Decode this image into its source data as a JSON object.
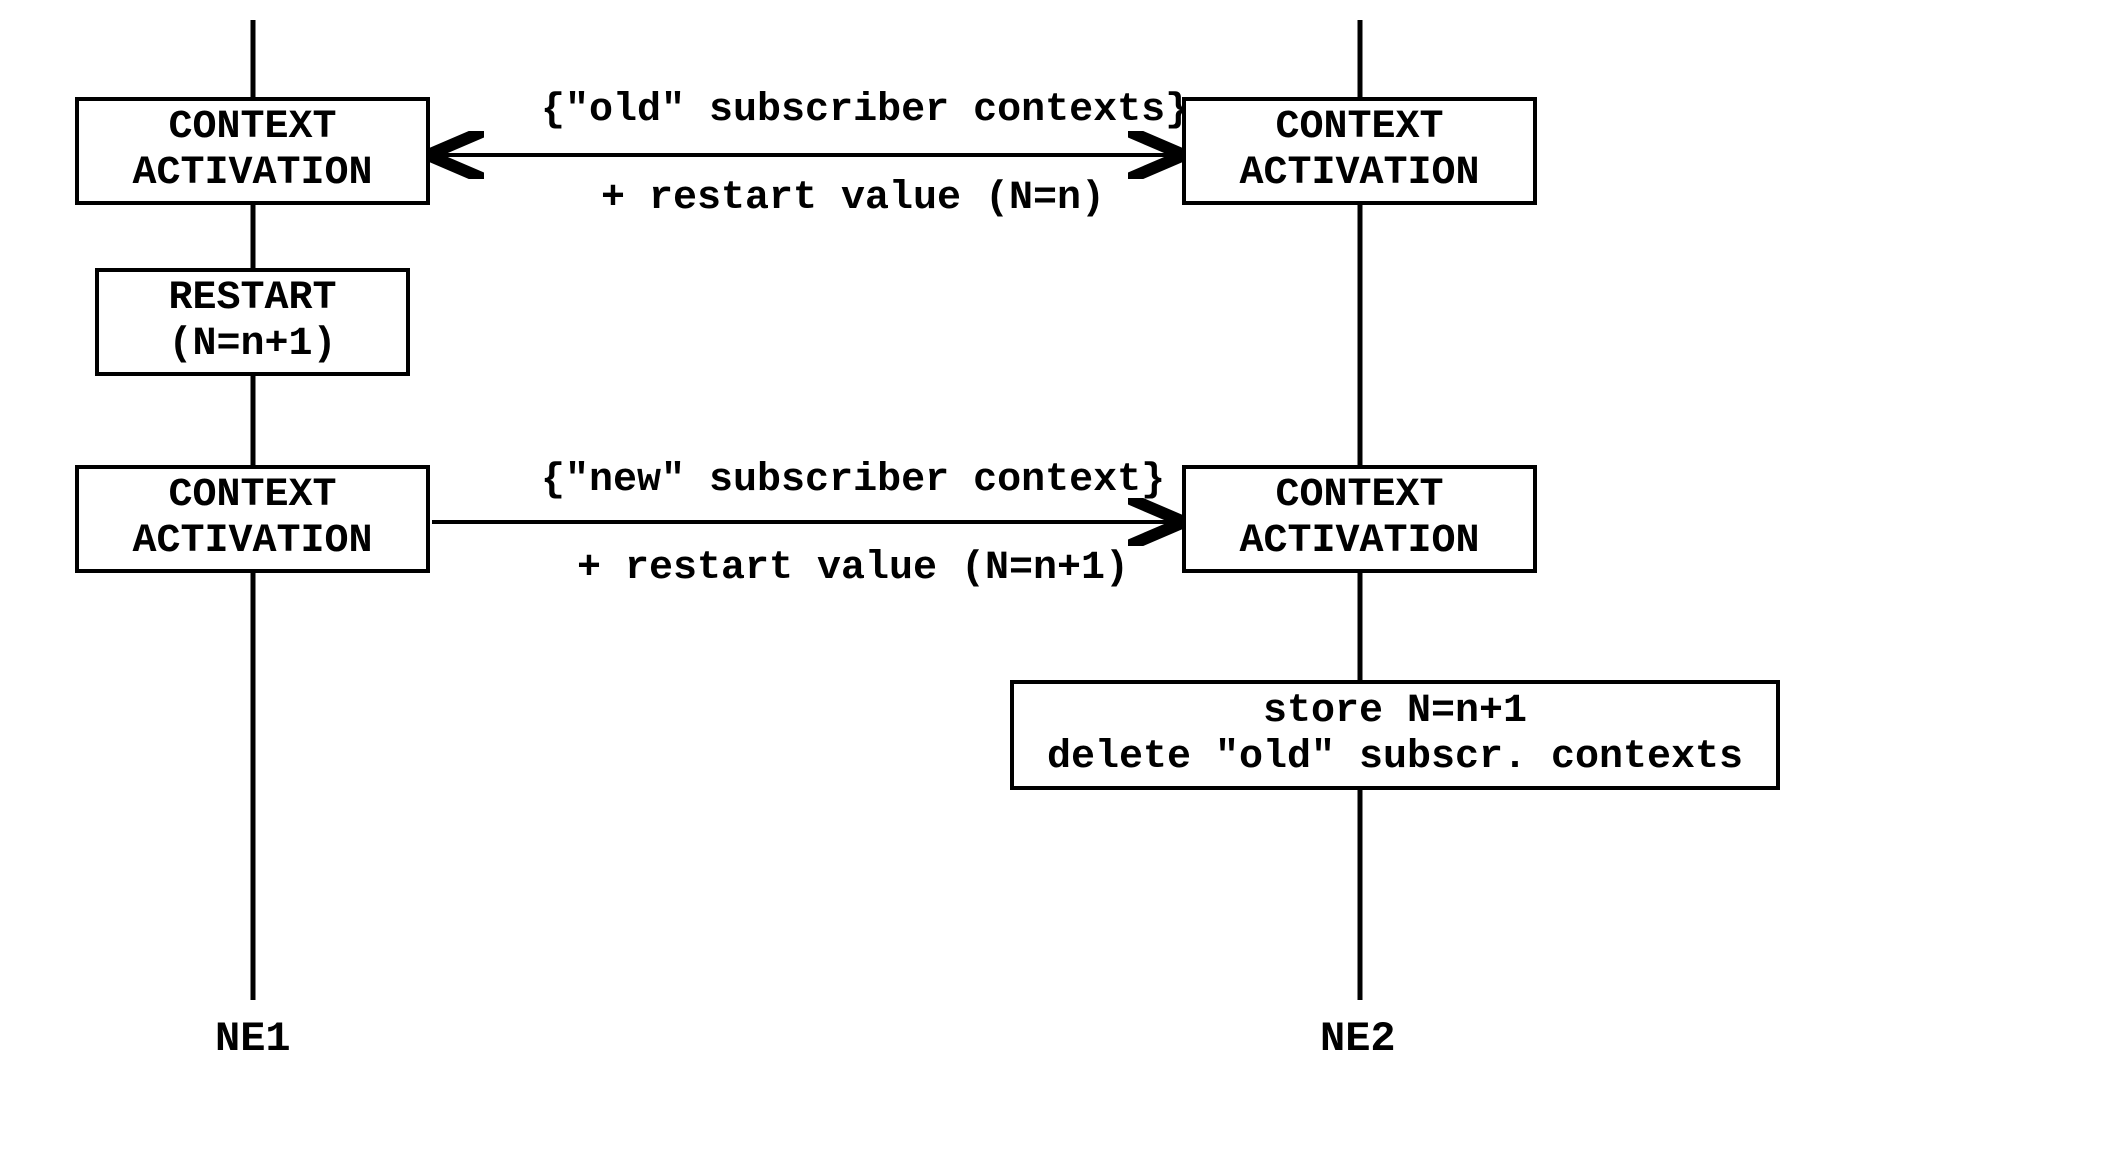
{
  "lifelines": {
    "left": "NE1",
    "right": "NE2"
  },
  "boxes": {
    "leftTop": {
      "line1": "CONTEXT",
      "line2": "ACTIVATION"
    },
    "rightTop": {
      "line1": "CONTEXT",
      "line2": "ACTIVATION"
    },
    "restart": {
      "line1": "RESTART",
      "line2": "(N=n+1)"
    },
    "leftMid": {
      "line1": "CONTEXT",
      "line2": "ACTIVATION"
    },
    "rightMid": {
      "line1": "CONTEXT",
      "line2": "ACTIVATION"
    },
    "store": {
      "line1": "store N=n+1",
      "line2": "delete \"old\" subscr. contexts"
    }
  },
  "messages": {
    "msg1": {
      "line1": "{\"old\" subscriber contexts}",
      "line2": "+ restart value (N=n)"
    },
    "msg2": {
      "line1": "{\"new\" subscriber context}",
      "line2": "+ restart value (N=n+1)"
    }
  }
}
